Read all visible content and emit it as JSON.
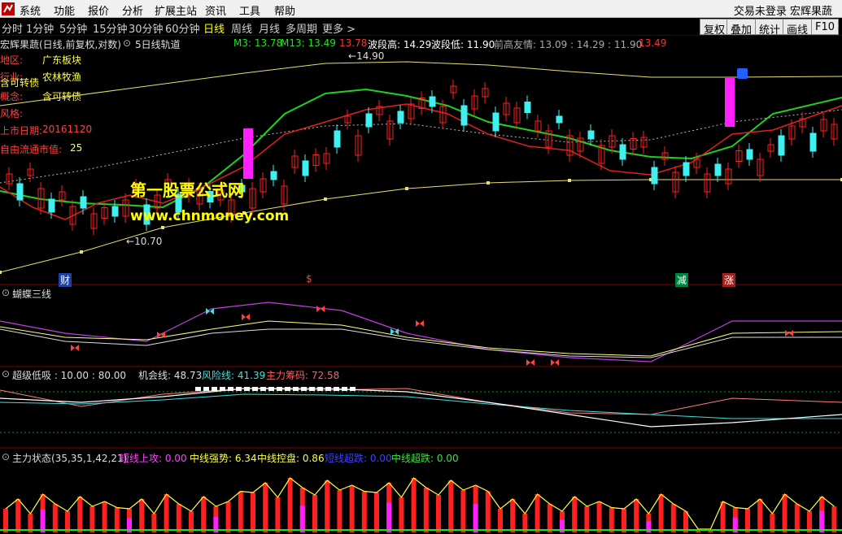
{
  "menu": {
    "items": [
      "系统",
      "功能",
      "报价",
      "分析",
      "扩展主站",
      "资讯",
      "工具",
      "帮助"
    ],
    "right_text": "交易未登录  宏辉果蔬"
  },
  "periods": {
    "items": [
      "分时",
      "1分钟",
      "5分钟",
      "15分钟",
      "30分钟",
      "60分钟",
      "日线",
      "周线",
      "月线",
      "多周期",
      "更多 >"
    ],
    "active": "日线",
    "right_tabs": [
      "复权",
      "叠加",
      "统计",
      "画线",
      "F10"
    ]
  },
  "header": {
    "stock": "宏辉果蔬(日线,前复权,对数)",
    "indicator": "5日线轨道",
    "m3": "M3: 13.78",
    "m13": "M13: 13.49",
    "price": "13.78",
    "wave_high": "波段高: 14.29",
    "wave_low": "波段低: 11.90",
    "prev_label": "前高友情: 13.09 : 14.29 : 11.90",
    "last": "13.49"
  },
  "info": {
    "region_label": "地区:",
    "region": "广东板块",
    "industry_label": "行业:",
    "industry": "农林牧渔",
    "concept_label": "概念:",
    "concept": "含可转债",
    "convert_label": "含可转债",
    "style_label": "风格:",
    "listing_label": "上市日期:",
    "listing": "20161120",
    "float_label": "自由流通市值:",
    "float": "25"
  },
  "annotations": {
    "high": "14.90",
    "low": "10.70",
    "marks": [
      "财",
      "$",
      "减",
      "涨"
    ]
  },
  "watermark": {
    "line1": "第一股票公式网",
    "line2": "www.chnmoney.com"
  },
  "panel1": {
    "title": "蝴蝶三线"
  },
  "panel2": {
    "title": "超级低吸 : 10.00 : 80.00",
    "chance": "机会线: 48.73",
    "risk": "风险线: 41.39",
    "chips": "主力筹码: 72.58"
  },
  "panel3": {
    "title": "主力状态(35,35,1,42,21)",
    "short_up": "短线上攻: 0.00",
    "mid_strong": "中线强势: 6.34",
    "mid_control": "中线控盘: 0.86",
    "short_super": "短线超跌: 0.00",
    "mid_super": "中线超跌: 0.00"
  },
  "colors": {
    "up": "#ff2020",
    "down": "#40f0f0",
    "ma_red": "#e02020",
    "ma_green": "#20d020",
    "ma_yellow": "#e8e070",
    "magenta": "#ff20ff"
  }
}
